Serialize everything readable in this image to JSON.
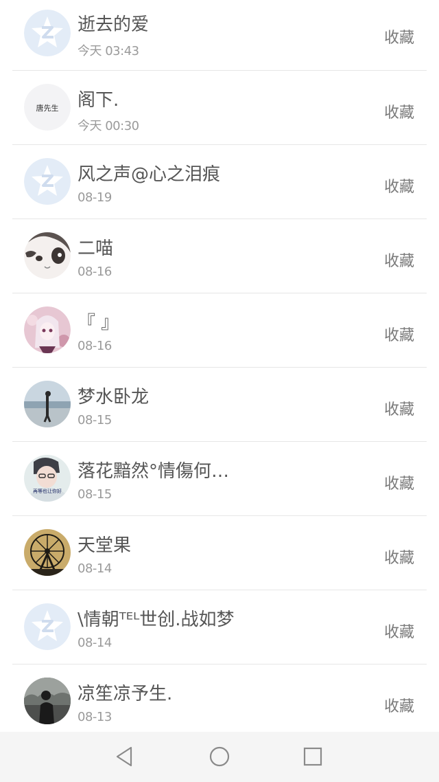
{
  "contacts": [
    {
      "name": "逝去的爱",
      "time": "今天 03:43",
      "action": "收藏",
      "avatar": "qzone-star-icon"
    },
    {
      "name": "阁下.",
      "time": "今天 00:30",
      "action": "收藏",
      "avatar": "text-avatar",
      "avatar_text": "唐先生"
    },
    {
      "name": "风之声@心之泪痕",
      "time": "08-19",
      "action": "收藏",
      "avatar": "qzone-star-icon"
    },
    {
      "name": "二喵",
      "time": "08-16",
      "action": "收藏",
      "avatar": "cat-photo"
    },
    {
      "name": "『 』",
      "time": "08-16",
      "action": "收藏",
      "avatar": "anime-girl-photo"
    },
    {
      "name": "梦水卧龙",
      "time": "08-15",
      "action": "收藏",
      "avatar": "beach-person-photo"
    },
    {
      "name": "落花黯然°情傷何…",
      "time": "08-15",
      "action": "收藏",
      "avatar": "person-with-caption-photo",
      "avatar_text": "再等也让你好"
    },
    {
      "name": "天堂果",
      "time": "08-14",
      "action": "收藏",
      "avatar": "ferris-wheel-photo"
    },
    {
      "name": "\\情朝ᵀᴱᴸ世创.战如梦",
      "time": "08-14",
      "action": "收藏",
      "avatar": "qzone-star-icon"
    },
    {
      "name": "凉笙凉予生.",
      "time": "08-13",
      "action": "收藏",
      "avatar": "dark-person-photo"
    }
  ],
  "navbar": {
    "back": "back-triangle-icon",
    "home": "home-circle-icon",
    "recent": "recent-square-icon"
  },
  "colors": {
    "name_text": "#555555",
    "time_text": "#9a9a9a",
    "action_text": "#7a7a7a",
    "divider": "#e6e6e6",
    "qzone_bg": "#e3ecf7",
    "qzone_star": "#ffffff"
  }
}
